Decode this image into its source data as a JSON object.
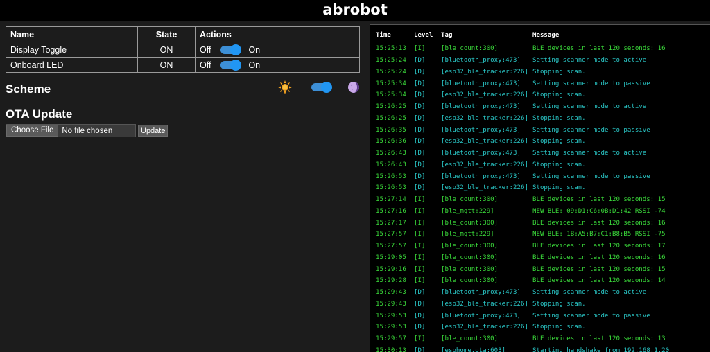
{
  "app": {
    "title": "abrobot"
  },
  "controls": {
    "headers": {
      "name": "Name",
      "state": "State",
      "actions": "Actions"
    },
    "rows": [
      {
        "name": "Display Toggle",
        "state": "ON",
        "off_label": "Off",
        "on_label": "On"
      },
      {
        "name": "Onboard LED",
        "state": "ON",
        "off_label": "Off",
        "on_label": "On"
      }
    ]
  },
  "scheme": {
    "title": "Scheme"
  },
  "ota": {
    "title": "OTA Update",
    "choose_label": "Choose File",
    "file_status": "No file chosen",
    "update_label": "Update"
  },
  "log": {
    "headers": {
      "time": "Time",
      "level": "Level",
      "tag": "Tag",
      "message": "Message"
    },
    "rows": [
      {
        "time": "15:25:13",
        "level": "[I]",
        "tag": "[ble_count:300]",
        "msg": "BLE devices in last 120 seconds: 16"
      },
      {
        "time": "15:25:24",
        "level": "[D]",
        "tag": "[bluetooth_proxy:473]",
        "msg": "Setting scanner mode to active"
      },
      {
        "time": "15:25:24",
        "level": "[D]",
        "tag": "[esp32_ble_tracker:226]",
        "msg": "Stopping scan."
      },
      {
        "time": "15:25:34",
        "level": "[D]",
        "tag": "[bluetooth_proxy:473]",
        "msg": "Setting scanner mode to passive"
      },
      {
        "time": "15:25:34",
        "level": "[D]",
        "tag": "[esp32_ble_tracker:226]",
        "msg": "Stopping scan."
      },
      {
        "time": "15:26:25",
        "level": "[D]",
        "tag": "[bluetooth_proxy:473]",
        "msg": "Setting scanner mode to active"
      },
      {
        "time": "15:26:25",
        "level": "[D]",
        "tag": "[esp32_ble_tracker:226]",
        "msg": "Stopping scan."
      },
      {
        "time": "15:26:35",
        "level": "[D]",
        "tag": "[bluetooth_proxy:473]",
        "msg": "Setting scanner mode to passive"
      },
      {
        "time": "15:26:36",
        "level": "[D]",
        "tag": "[esp32_ble_tracker:226]",
        "msg": "Stopping scan."
      },
      {
        "time": "15:26:43",
        "level": "[D]",
        "tag": "[bluetooth_proxy:473]",
        "msg": "Setting scanner mode to active"
      },
      {
        "time": "15:26:43",
        "level": "[D]",
        "tag": "[esp32_ble_tracker:226]",
        "msg": "Stopping scan."
      },
      {
        "time": "15:26:53",
        "level": "[D]",
        "tag": "[bluetooth_proxy:473]",
        "msg": "Setting scanner mode to passive"
      },
      {
        "time": "15:26:53",
        "level": "[D]",
        "tag": "[esp32_ble_tracker:226]",
        "msg": "Stopping scan."
      },
      {
        "time": "15:27:14",
        "level": "[I]",
        "tag": "[ble_count:300]",
        "msg": "BLE devices in last 120 seconds: 15"
      },
      {
        "time": "15:27:16",
        "level": "[I]",
        "tag": "[ble_mqtt:229]",
        "msg": "NEW BLE: 09:D1:C6:0B:D1:42    RSSI -74"
      },
      {
        "time": "15:27:17",
        "level": "[I]",
        "tag": "[ble_count:300]",
        "msg": "BLE devices in last 120 seconds: 16"
      },
      {
        "time": "15:27:57",
        "level": "[I]",
        "tag": "[ble_mqtt:229]",
        "msg": "NEW BLE: 1B:A5:B7:C1:B8:B5    RSSI -75"
      },
      {
        "time": "15:27:57",
        "level": "[I]",
        "tag": "[ble_count:300]",
        "msg": "BLE devices in last 120 seconds: 17"
      },
      {
        "time": "15:29:05",
        "level": "[I]",
        "tag": "[ble_count:300]",
        "msg": "BLE devices in last 120 seconds: 16"
      },
      {
        "time": "15:29:16",
        "level": "[I]",
        "tag": "[ble_count:300]",
        "msg": "BLE devices in last 120 seconds: 15"
      },
      {
        "time": "15:29:28",
        "level": "[I]",
        "tag": "[ble_count:300]",
        "msg": "BLE devices in last 120 seconds: 14"
      },
      {
        "time": "15:29:43",
        "level": "[D]",
        "tag": "[bluetooth_proxy:473]",
        "msg": "Setting scanner mode to active"
      },
      {
        "time": "15:29:43",
        "level": "[D]",
        "tag": "[esp32_ble_tracker:226]",
        "msg": "Stopping scan."
      },
      {
        "time": "15:29:53",
        "level": "[D]",
        "tag": "[bluetooth_proxy:473]",
        "msg": "Setting scanner mode to passive"
      },
      {
        "time": "15:29:53",
        "level": "[D]",
        "tag": "[esp32_ble_tracker:226]",
        "msg": "Stopping scan."
      },
      {
        "time": "15:29:57",
        "level": "[I]",
        "tag": "[ble_count:300]",
        "msg": "BLE devices in last 120 seconds: 13"
      },
      {
        "time": "15:30:13",
        "level": "[D]",
        "tag": "[esphome.ota:603]",
        "msg": "Starting handshake from 192.168.1.20"
      }
    ]
  },
  "colors": {
    "info": "#3ad93a",
    "debug": "#2ac7c7",
    "toggle_on": "#2196f3",
    "background": "#1c1c1c",
    "log_background": "#000000"
  },
  "icons": {
    "sun": "sun-icon",
    "moon": "moon-icon"
  }
}
